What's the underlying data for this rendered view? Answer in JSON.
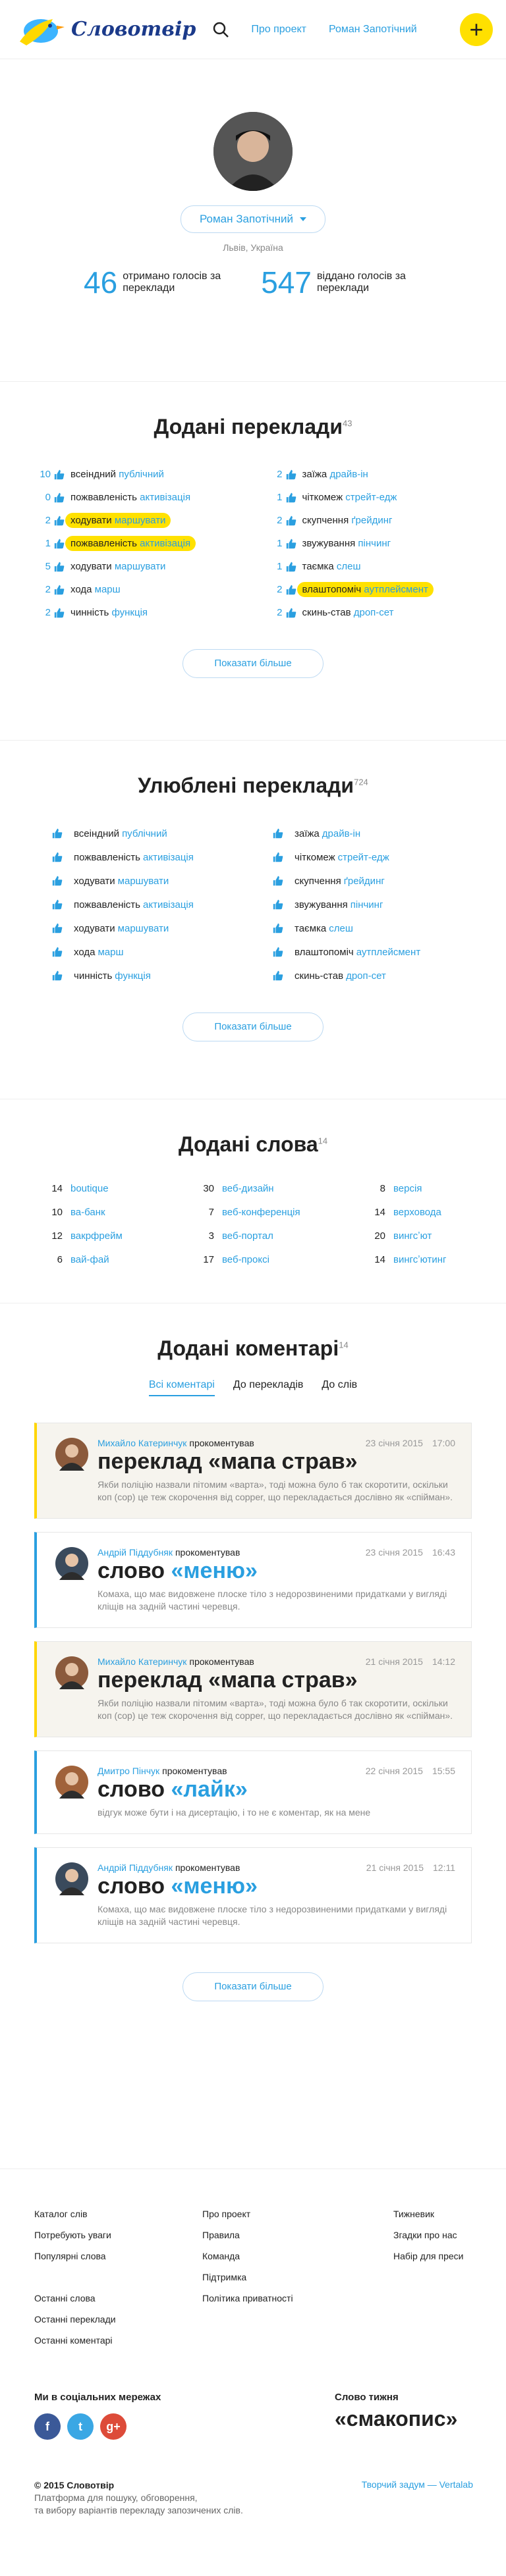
{
  "header": {
    "logo_text": "Словотвір",
    "nav": [
      "Про проект",
      "Роман Запотічний"
    ],
    "add_label": "+"
  },
  "profile": {
    "name": "Роман Запотічний",
    "location": "Львів, Україна",
    "stats": [
      {
        "num": "46",
        "label": "отримано голосів за переклади"
      },
      {
        "num": "547",
        "label": "віддано голосів за переклади"
      }
    ]
  },
  "added_translations": {
    "title": "Додані переклади",
    "count": "43",
    "more": "Показати більше",
    "left": [
      {
        "cnt": "10",
        "ua": "всеіндний",
        "en": "публічний",
        "hl": false
      },
      {
        "cnt": "0",
        "ua": "пожвавленість",
        "en": "активізація",
        "hl": false
      },
      {
        "cnt": "2",
        "ua": "ходувати",
        "en": "маршувати",
        "hl": true
      },
      {
        "cnt": "1",
        "ua": "пожвавленість",
        "en": "активізація",
        "hl": true
      },
      {
        "cnt": "5",
        "ua": "ходувати",
        "en": "маршувати",
        "hl": false
      },
      {
        "cnt": "2",
        "ua": "хода",
        "en": "марш",
        "hl": false
      },
      {
        "cnt": "2",
        "ua": "чинність",
        "en": "функція",
        "hl": false
      }
    ],
    "right": [
      {
        "cnt": "2",
        "ua": "заїжа",
        "en": "драйв-ін",
        "hl": false
      },
      {
        "cnt": "1",
        "ua": "чіткомеж",
        "en": "стрейт-едж",
        "hl": false
      },
      {
        "cnt": "2",
        "ua": "скупчення",
        "en": "ґрейдинг",
        "hl": false
      },
      {
        "cnt": "1",
        "ua": "звужування",
        "en": "пінчинг",
        "hl": false
      },
      {
        "cnt": "1",
        "ua": "таємка",
        "en": "слеш",
        "hl": false
      },
      {
        "cnt": "2",
        "ua": "влаштопоміч",
        "en": "аутплейсмент",
        "hl": true
      },
      {
        "cnt": "2",
        "ua": "скинь-став",
        "en": "дроп-сет",
        "hl": false
      }
    ]
  },
  "favorite_translations": {
    "title": "Улюблені переклади",
    "count": "724",
    "more": "Показати більше",
    "left": [
      {
        "ua": "всеіндний",
        "en": "публічний"
      },
      {
        "ua": "пожвавленість",
        "en": "активізація"
      },
      {
        "ua": "ходувати",
        "en": "маршувати"
      },
      {
        "ua": "пожвавленість",
        "en": "активізація"
      },
      {
        "ua": "ходувати",
        "en": "маршувати"
      },
      {
        "ua": "хода",
        "en": "марш"
      },
      {
        "ua": "чинність",
        "en": "функція"
      }
    ],
    "right": [
      {
        "ua": "заїжа",
        "en": "драйв-ін"
      },
      {
        "ua": "чіткомеж",
        "en": "стрейт-едж"
      },
      {
        "ua": "скупчення",
        "en": "ґрейдинг"
      },
      {
        "ua": "звужування",
        "en": "пінчинг"
      },
      {
        "ua": "таємка",
        "en": "слеш"
      },
      {
        "ua": "влаштопоміч",
        "en": "аутплейсмент"
      },
      {
        "ua": "скинь-став",
        "en": "дроп-сет"
      }
    ]
  },
  "added_words": {
    "title": "Додані слова",
    "count": "14",
    "columns": [
      [
        {
          "cnt": "14",
          "word": "boutique"
        },
        {
          "cnt": "10",
          "word": "ва-банк"
        },
        {
          "cnt": "12",
          "word": "вакрфрейм"
        },
        {
          "cnt": "6",
          "word": "вай-фай"
        }
      ],
      [
        {
          "cnt": "30",
          "word": "веб-дизайн"
        },
        {
          "cnt": "7",
          "word": "веб-конференція"
        },
        {
          "cnt": "3",
          "word": "веб-портал"
        },
        {
          "cnt": "17",
          "word": "веб-проксі"
        }
      ],
      [
        {
          "cnt": "8",
          "word": "версія"
        },
        {
          "cnt": "14",
          "word": "верховода"
        },
        {
          "cnt": "20",
          "word": "вингсʼют"
        },
        {
          "cnt": "14",
          "word": "вингсʼютинг"
        }
      ]
    ]
  },
  "comments": {
    "title": "Додані коментарі",
    "count": "14",
    "tabs": [
      "Всі коментарі",
      "До перекладів",
      "До слів"
    ],
    "more": "Показати більше",
    "items": [
      {
        "author": "Михайло Катеринчук",
        "action": "прокоментував",
        "date": "23 січня 2015",
        "time": "17:00",
        "t_prefix": "переклад ",
        "t_quote": "«мапа страв»",
        "text": "Якби поліцію назвали пітомим «варта», тоді можна було б так скоротити, оскільки коп (cop) це теж скорочення від copper, що перекладається дослівно як «спійман».",
        "yellow": true,
        "av": "#8b5a3c"
      },
      {
        "author": "Андрій Піддубняк",
        "action": "прокоментував",
        "date": "23 січня 2015",
        "time": "16:43",
        "t_prefix": "слово ",
        "t_quote": "«меню»",
        "text": "Комаха, що має видовжене плоске тіло з недорозвиненими придатками у вигляді кліщів на задній частині черевця.",
        "yellow": false,
        "av": "#3a4a5c"
      },
      {
        "author": "Михайло Катеринчук",
        "action": "прокоментував",
        "date": "21 січня 2015",
        "time": "14:12",
        "t_prefix": "переклад ",
        "t_quote": "«мапа страв»",
        "text": "Якби поліцію назвали пітомим «варта», тоді можна було б так скоротити, оскільки коп (cop) це теж скорочення від copper, що перекладається дослівно як «спійман».",
        "yellow": true,
        "av": "#8b5a3c"
      },
      {
        "author": "Дмитро Пінчук",
        "action": "прокоментував",
        "date": "22 січня 2015",
        "time": "15:55",
        "t_prefix": "слово ",
        "t_quote": "«лайк»",
        "text": "відгук може бути і на дисертацію, і то не є коментар, як на мене",
        "yellow": false,
        "av": "#a0623a"
      },
      {
        "author": "Андрій Піддубняк",
        "action": "прокоментував",
        "date": "21 січня 2015",
        "time": "12:11",
        "t_prefix": "слово ",
        "t_quote": "«меню»",
        "text": "Комаха, що має видовжене плоске тіло з недорозвиненими придатками у вигляді кліщів на задній частині черевця.",
        "yellow": false,
        "av": "#3a4a5c"
      }
    ]
  },
  "footer": {
    "col1": [
      "Каталог слів",
      "Потребують уваги",
      "Популярні слова",
      "",
      "Останні слова",
      "Останні переклади",
      "Останні коментарі"
    ],
    "col2": [
      "Про проект",
      "Правила",
      "Команда",
      "Підтримка",
      "Політика приватності"
    ],
    "col3": [
      "Тижневик",
      "Згадки про нас",
      "Набір для преси"
    ],
    "social_title": "Ми в соціальних мережах",
    "social": [
      {
        "label": "f",
        "color": "#3b5998"
      },
      {
        "label": "t",
        "color": "#3aa7e4"
      },
      {
        "label": "g+",
        "color": "#dd4b39"
      }
    ],
    "wotd_title": "Слово тижня",
    "wotd": "«смакопис»",
    "copy": [
      "© 2015 Словотвір",
      "Платформа для пошуку, обговорення,",
      "та вибору варіантів перекладу запозичених слів."
    ],
    "credit": "Творчий задум — Vertalab"
  },
  "colors": {
    "accent": "#2a9fe0",
    "highlight": "#ffe100",
    "brand": "#1b3a8a"
  }
}
